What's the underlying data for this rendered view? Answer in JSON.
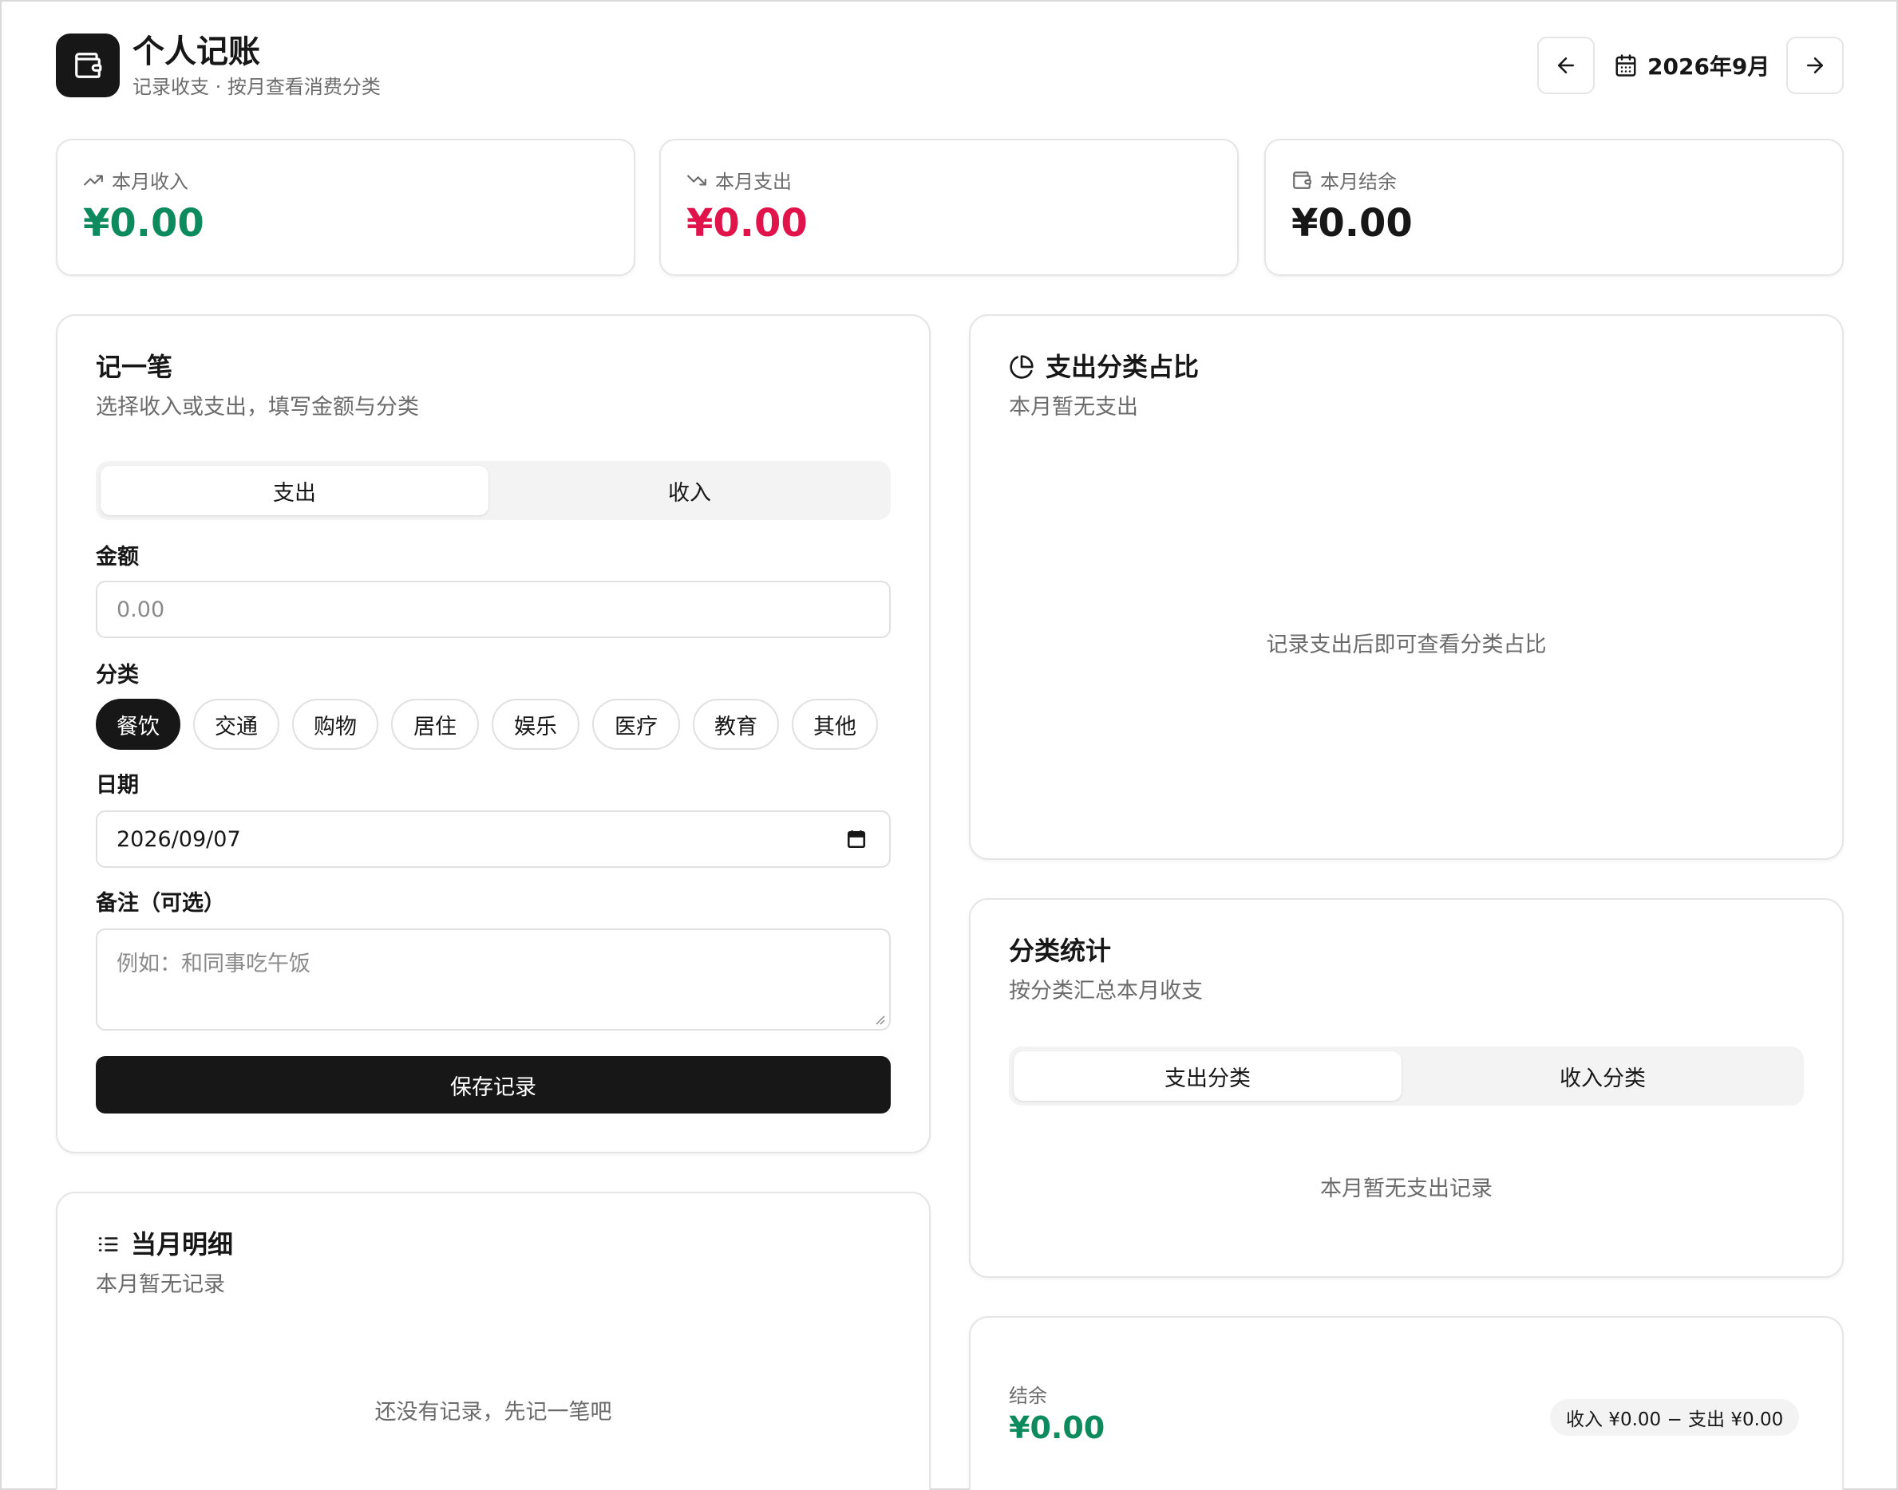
{
  "header": {
    "title": "个人记账",
    "subtitle": "记录收支 · 按月查看消费分类",
    "month": "2026年9月"
  },
  "stats": [
    {
      "label": "本月收入",
      "value": "¥0.00",
      "color": "#0e8a5f",
      "icon": "trending-up-icon"
    },
    {
      "label": "本月支出",
      "value": "¥0.00",
      "color": "#e0134a",
      "icon": "trending-down-icon"
    },
    {
      "label": "本月结余",
      "value": "¥0.00",
      "color": "#171717",
      "icon": "wallet-icon"
    }
  ],
  "entry_form": {
    "title": "记一笔",
    "description": "选择收入或支出，填写金额与分类",
    "type_tabs": [
      "支出",
      "收入"
    ],
    "active_type": "支出",
    "amount_label": "金额",
    "amount_placeholder": "0.00",
    "category_label": "分类",
    "categories": [
      "餐饮",
      "交通",
      "购物",
      "居住",
      "娱乐",
      "医疗",
      "教育",
      "其他"
    ],
    "selected_category": "餐饮",
    "date_label": "日期",
    "date_value": "2026/09/07",
    "note_label": "备注（可选）",
    "note_placeholder": "例如：和同事吃午饭",
    "save_label": "保存记录"
  },
  "pie_card": {
    "title": "支出分类占比",
    "description": "本月暂无支出",
    "empty_text": "记录支出后即可查看分类占比"
  },
  "category_stats": {
    "title": "分类统计",
    "description": "按分类汇总本月收支",
    "tabs": [
      "支出分类",
      "收入分类"
    ],
    "active_tab": "支出分类",
    "empty_text": "本月暂无支出记录"
  },
  "details": {
    "title": "当月明细",
    "description": "本月暂无记录",
    "empty_text": "还没有记录，先记一笔吧"
  },
  "balance_card": {
    "label": "结余",
    "value": "¥0.00",
    "formula": "收入 ¥0.00 − 支出 ¥0.00"
  },
  "colors": {
    "income": "#0e8a5f",
    "expense": "#e0134a",
    "primary": "#171717"
  }
}
